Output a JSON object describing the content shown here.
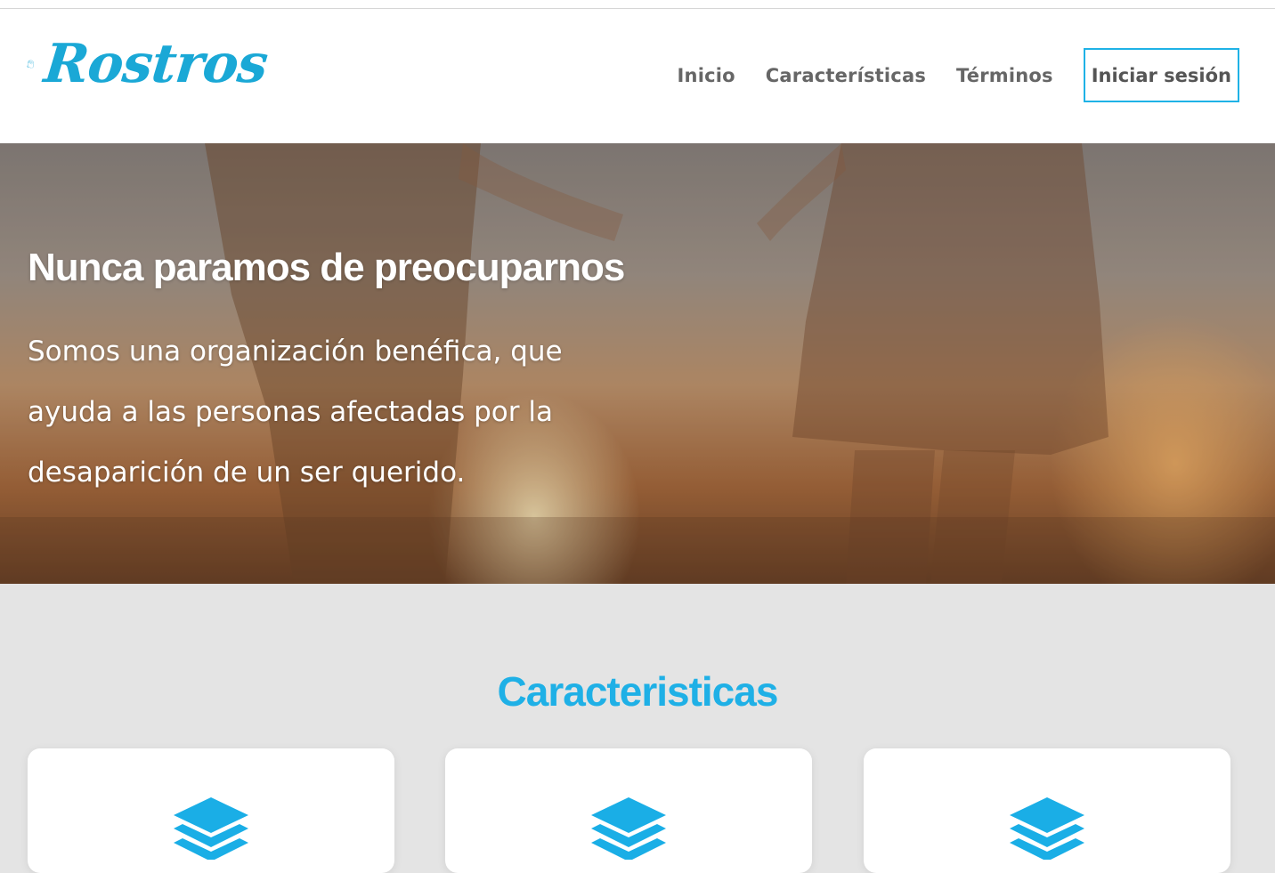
{
  "brand": {
    "name": "Rostros",
    "logo_icon": "woman-profile-icon",
    "color": "#1aa8d6"
  },
  "nav": {
    "items": [
      {
        "label": "Inicio"
      },
      {
        "label": "Características"
      },
      {
        "label": "Términos"
      }
    ],
    "login_label": "Iniciar sesión",
    "login_border_color": "#1fb2e6"
  },
  "hero": {
    "title": "Nunca paramos de preocuparnos",
    "text": "Somos una organización benéfica, que ayuda a las personas afectadas por la desaparición de un ser querido."
  },
  "features": {
    "title": "Caracteristicas",
    "title_color": "#1fb0e6",
    "cards": [
      {
        "icon": "layers-icon"
      },
      {
        "icon": "layers-icon"
      },
      {
        "icon": "layers-icon"
      }
    ]
  }
}
